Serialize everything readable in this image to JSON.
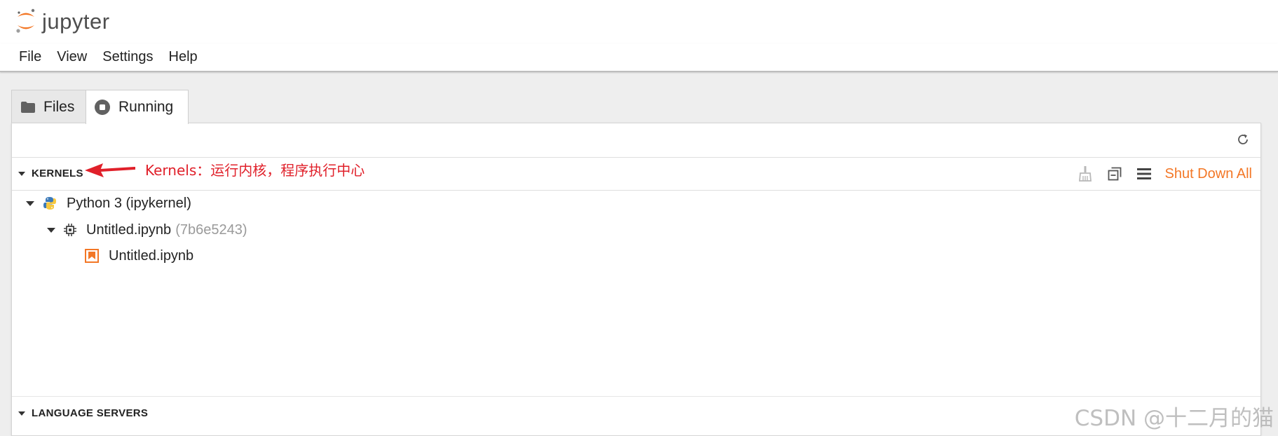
{
  "app": {
    "logo_text": "jupyter",
    "brand_color": "#f37726"
  },
  "menu": [
    "File",
    "View",
    "Settings",
    "Help"
  ],
  "tabs": [
    {
      "label": "Files",
      "icon": "folder-icon",
      "active": false
    },
    {
      "label": "Running",
      "icon": "stop-circle-icon",
      "active": true
    }
  ],
  "toolbar": {
    "refresh_icon": "refresh-icon"
  },
  "kernels_section": {
    "title": "KERNELS",
    "annotation": "Kernels：运行内核，程序执行中心",
    "annotation_color": "#e0202a",
    "actions": {
      "clear_icon": "broom-icon",
      "collapse_icon": "collapse-all-icon",
      "list_icon": "list-icon",
      "shutdown_all": "Shut Down All"
    },
    "kernels": [
      {
        "name": "Python 3 (ipykernel)",
        "icon": "python-icon",
        "sessions": [
          {
            "name": "Untitled.ipynb",
            "id": "(7b6e5243)",
            "icon": "kernel-chip-icon",
            "documents": [
              {
                "name": "Untitled.ipynb",
                "icon": "notebook-icon"
              }
            ]
          }
        ]
      }
    ]
  },
  "language_servers_section": {
    "title": "LANGUAGE SERVERS"
  },
  "watermark": "CSDN @十二月的猫"
}
